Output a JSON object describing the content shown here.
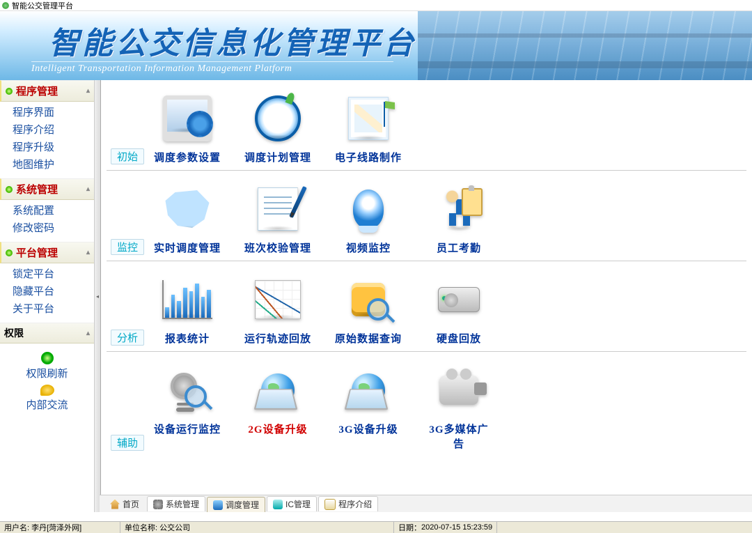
{
  "window": {
    "title": "智能公交管理平台"
  },
  "banner": {
    "title": "智能公交信息化管理平台",
    "subtitle": "Intelligent Transportation Information Management Platform"
  },
  "sidebar": {
    "groups": [
      {
        "title": "程序管理",
        "items": [
          "程序界面",
          "程序介绍",
          "程序升级",
          "地图维护"
        ]
      },
      {
        "title": "系统管理",
        "items": [
          "系统配置",
          "修改密码"
        ]
      },
      {
        "title": "平台管理",
        "items": [
          "锁定平台",
          "隐藏平台",
          "关于平台"
        ]
      }
    ],
    "perm": {
      "title": "权限",
      "refresh": "权限刷新",
      "chat": "内部交流"
    }
  },
  "dashboard": {
    "sections": [
      {
        "label": "初始",
        "tiles": [
          {
            "label": "调度参数设置",
            "icon": "monitor-gear"
          },
          {
            "label": "调度计划管理",
            "icon": "clock"
          },
          {
            "label": "电子线路制作",
            "icon": "map-flag"
          }
        ]
      },
      {
        "label": "监控",
        "tiles": [
          {
            "label": "实时调度管理",
            "icon": "china-map"
          },
          {
            "label": "班次校验管理",
            "icon": "edit-doc"
          },
          {
            "label": "视频监控",
            "icon": "webcam"
          },
          {
            "label": "员工考勤",
            "icon": "runner-clip"
          }
        ]
      },
      {
        "label": "分析",
        "tiles": [
          {
            "label": "报表统计",
            "icon": "bar-chart"
          },
          {
            "label": "运行轨迹回放",
            "icon": "line-chart"
          },
          {
            "label": "原始数据查询",
            "icon": "db-search"
          },
          {
            "label": "硬盘回放",
            "icon": "hard-disk"
          }
        ]
      },
      {
        "label": "辅助",
        "tiles": [
          {
            "label": "设备运行监控",
            "icon": "mic-search"
          },
          {
            "label": "2G设备升级",
            "icon": "globe-laptop",
            "color": "red"
          },
          {
            "label": "3G设备升级",
            "icon": "globe-laptop"
          },
          {
            "label": "3G多媒体广告",
            "icon": "camcorder"
          }
        ]
      }
    ]
  },
  "bottomTabs": [
    {
      "label": "首页",
      "icon": "home",
      "active": false
    },
    {
      "label": "系统管理",
      "icon": "gear",
      "active": false
    },
    {
      "label": "调度管理",
      "icon": "bus",
      "active": true
    },
    {
      "label": "IC管理",
      "icon": "card",
      "active": false
    },
    {
      "label": "程序介绍",
      "icon": "doc",
      "active": false
    }
  ],
  "status": {
    "user_label": "用户名:",
    "user_value": "李丹[菏泽外网]",
    "org_label": "单位名称:",
    "org_value": "公交公司",
    "date_label": "日期：",
    "date_value": "2020-07-15 15:23:59"
  }
}
